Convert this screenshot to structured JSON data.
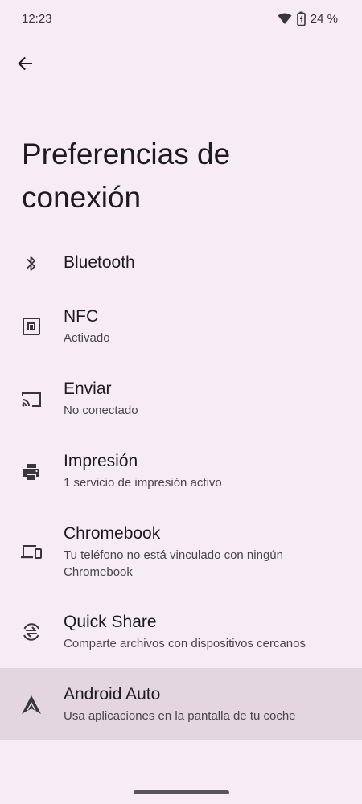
{
  "status_bar": {
    "time": "12:23",
    "battery_percent": "24 %",
    "icons": [
      "wifi-icon",
      "battery-saver-icon"
    ]
  },
  "header": {
    "back_icon": "arrow-left-icon",
    "title": "Preferencias de conexión"
  },
  "items": [
    {
      "icon": "bluetooth-icon",
      "title": "Bluetooth",
      "summary": ""
    },
    {
      "icon": "nfc-icon",
      "title": "NFC",
      "summary": "Activado"
    },
    {
      "icon": "cast-icon",
      "title": "Enviar",
      "summary": "No conectado"
    },
    {
      "icon": "printer-icon",
      "title": "Impresión",
      "summary": "1 servicio de impresión activo"
    },
    {
      "icon": "devices-icon",
      "title": "Chromebook",
      "summary": "Tu teléfono no está vinculado con ningún Chromebook"
    },
    {
      "icon": "quick-share-icon",
      "title": "Quick Share",
      "summary": "Comparte archivos con dispositivos cercanos"
    },
    {
      "icon": "android-auto-icon",
      "title": "Android Auto",
      "summary": "Usa aplicaciones en la pantalla de tu coche"
    }
  ],
  "colors": {
    "background": "#f8ecf4",
    "highlight": "#e3d6de",
    "text_primary": "#1f1a1e",
    "text_secondary": "#4b4549"
  }
}
